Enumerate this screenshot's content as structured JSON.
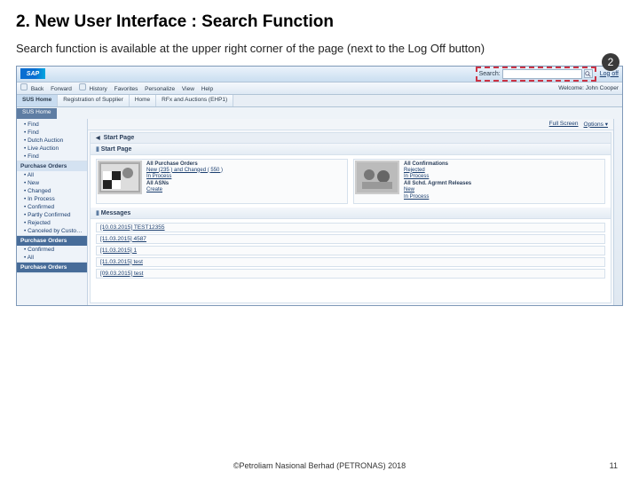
{
  "slide": {
    "title": "2. New User Interface : Search Function",
    "subtitle": "Search function is available at the upper right corner of the page (next to the Log Off button)"
  },
  "badge": "2",
  "header": {
    "logo": "SAP",
    "search_label": "Search:",
    "search_placeholder": "",
    "logoff": "Log off"
  },
  "menubar": {
    "items": [
      "Back",
      "Forward",
      "History",
      "Favorites",
      "Personalize",
      "View",
      "Help"
    ],
    "welcome": "Welcome: John Cooper"
  },
  "tabs": [
    "SUS Home",
    "Registration of Supplier",
    "Home",
    "RFx and Auctions (EHP1)"
  ],
  "subtab": "SUS Home",
  "sidebar": {
    "sections": [
      {
        "style": "plain",
        "items": [
          "Find",
          "Find",
          "Dutch Auction",
          "Live Auction",
          "Find"
        ]
      },
      {
        "header": "Purchase Orders",
        "style": "light",
        "items": [
          "All",
          "New",
          "Changed",
          "In Process",
          "Confirmed",
          "Partly Confirmed",
          "Rejected",
          "Canceled by Customer"
        ]
      },
      {
        "header": "Purchase Orders",
        "style": "dark",
        "items": [
          "Confirmed",
          "All"
        ]
      },
      {
        "header": "Purchase Orders",
        "style": "dark",
        "items": []
      }
    ]
  },
  "content": {
    "options": [
      "Full Screen",
      "Options ▾"
    ],
    "start_header": "Start Page",
    "panel1": "Start Page",
    "cards": [
      {
        "hd": "All Purchase Orders",
        "lines": [
          "New (235 ) and Changed ( 550 )",
          "In Process",
          "All ASNs",
          "Create"
        ]
      },
      {
        "hd": "All Confirmations",
        "lines": [
          "Rejected",
          "In Process",
          "All Schd. Agrmnt Releases",
          "New",
          "In Process"
        ]
      }
    ],
    "messages_hdr": "Messages",
    "messages": [
      "[10.03.2015] TEST12355",
      "[11.03.2015] 4587",
      "[11.03.2015] 1",
      "[11.03.2015] test",
      "[09.03.2015] test"
    ]
  },
  "footer": {
    "copyright": "©Petroliam Nasional Berhad (PETRONAS) 2018",
    "page": "11"
  }
}
